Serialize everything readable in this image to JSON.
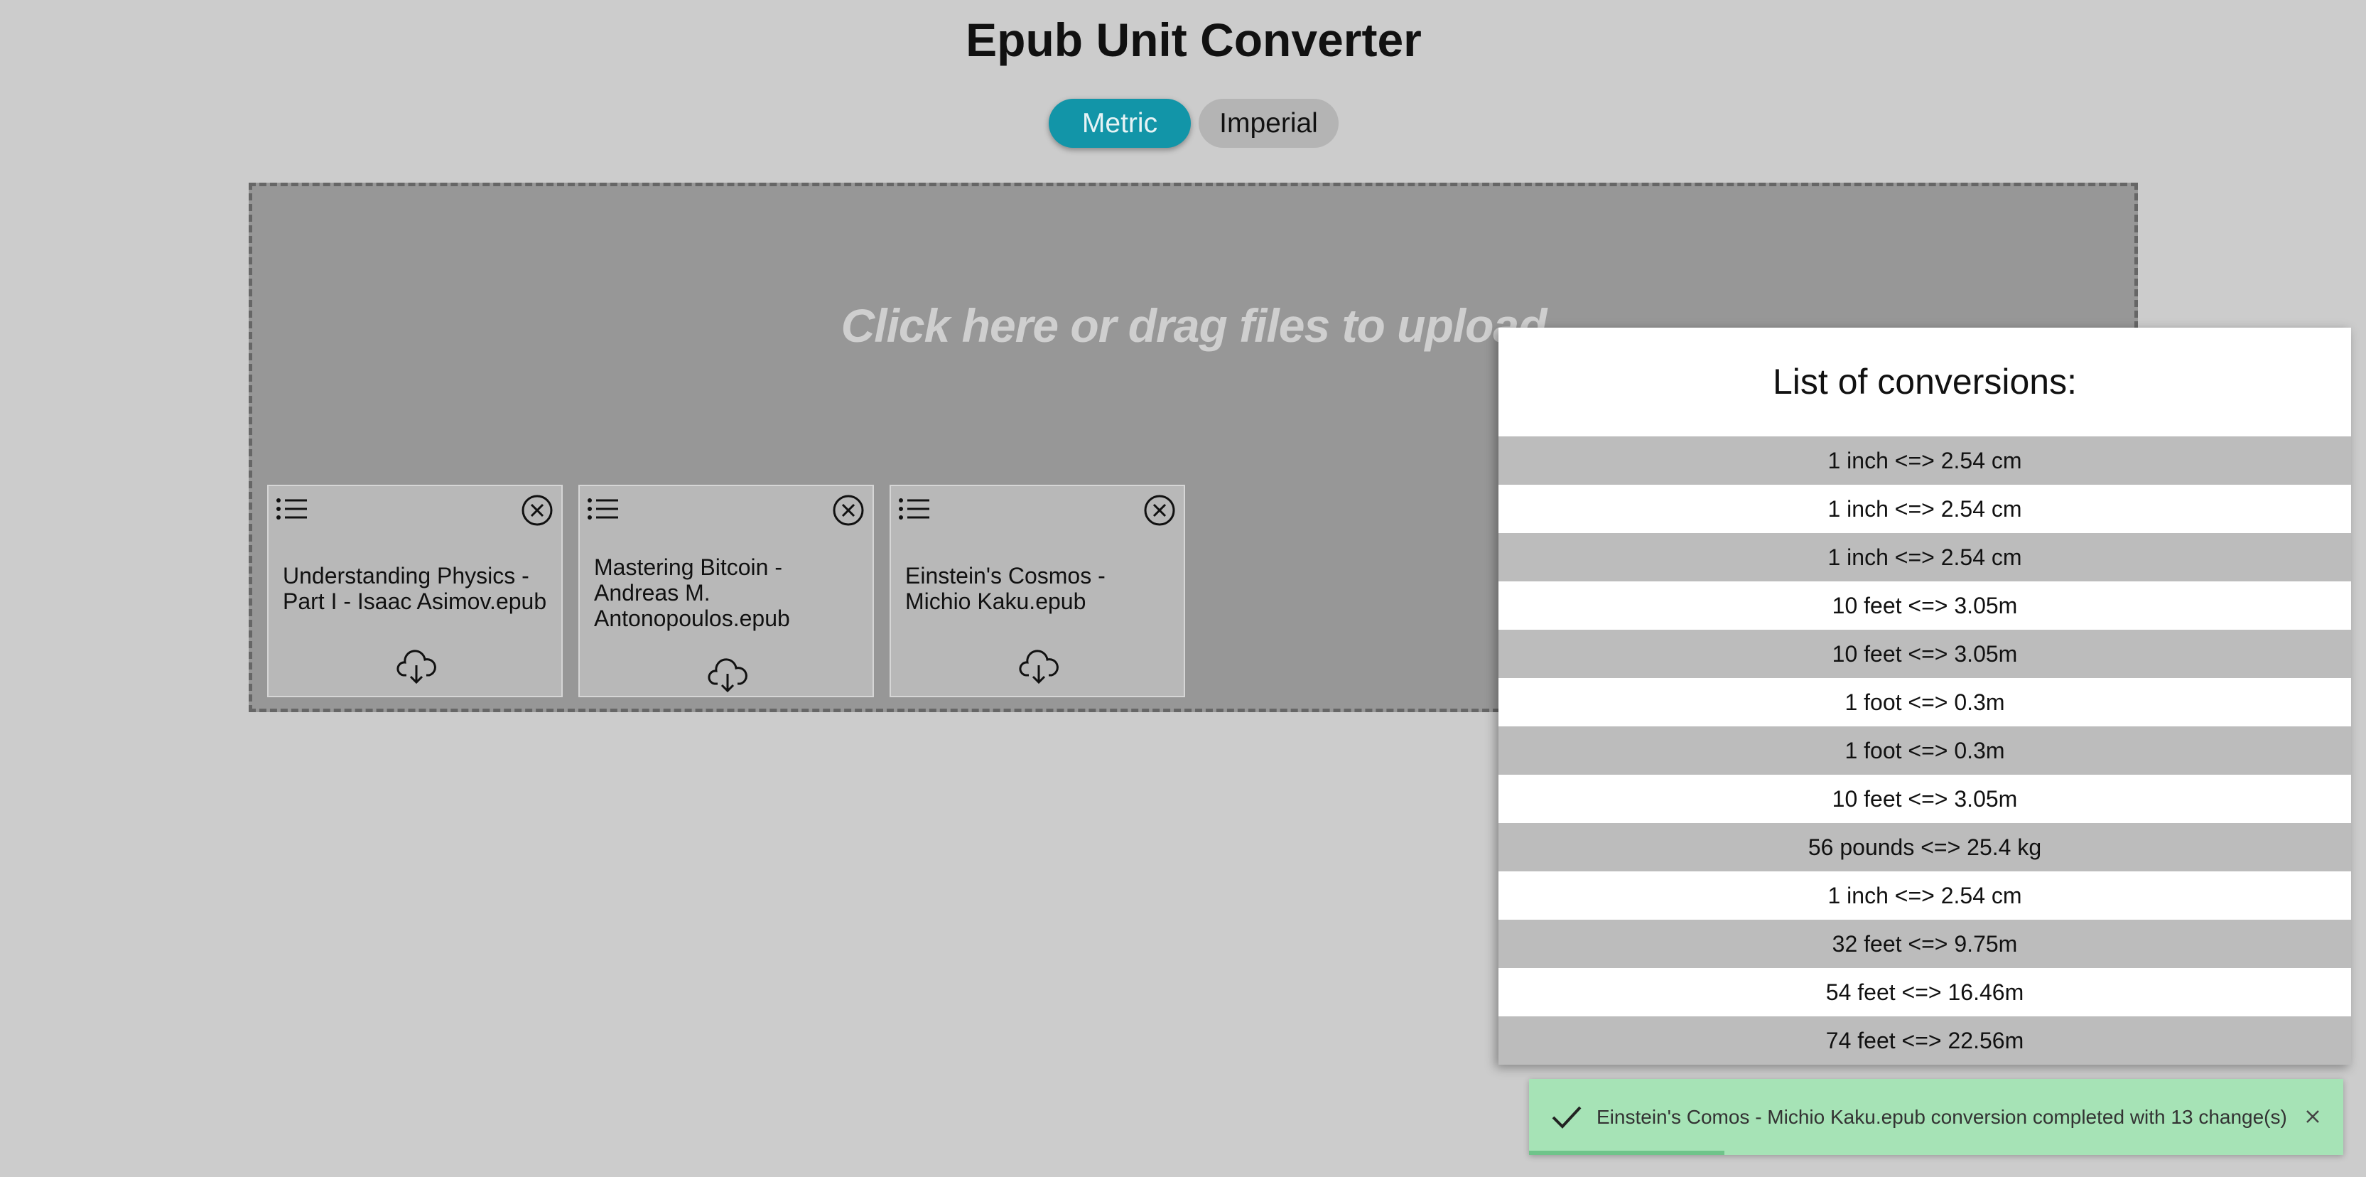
{
  "app": {
    "title": "Epub Unit Converter"
  },
  "unit_toggle": {
    "metric_label": "Metric",
    "imperial_label": "Imperial",
    "selected": "Metric"
  },
  "dropzone": {
    "hint": "Click here or drag files to upload"
  },
  "files": [
    {
      "name": "Understanding Physics - Part I - Isaac Asimov.epub"
    },
    {
      "name": "Mastering Bitcoin - Andreas M. Antonopoulos.epub"
    },
    {
      "name": "Einstein's Cosmos - Michio Kaku.epub"
    }
  ],
  "conversions_panel": {
    "title": "List of conversions:",
    "items": [
      "1 inch <=> 2.54 cm",
      "1 inch <=> 2.54 cm",
      "1 inch <=> 2.54 cm",
      "10 feet <=> 3.05m",
      "10 feet <=> 3.05m",
      "1 foot <=> 0.3m",
      "1 foot <=> 0.3m",
      "10 feet <=> 3.05m",
      "56 pounds <=> 25.4 kg",
      "1 inch <=> 2.54 cm",
      "32 feet <=> 9.75m",
      "54 feet <=> 16.46m",
      "74 feet <=> 22.56m"
    ]
  },
  "toast": {
    "message": "Einstein's Comos - Michio Kaku.epub conversion completed with 13 change(s)",
    "progress": 0.24,
    "color": "#a6e3b6"
  },
  "colors": {
    "accent": "#1295a8",
    "background": "#cccccc"
  }
}
